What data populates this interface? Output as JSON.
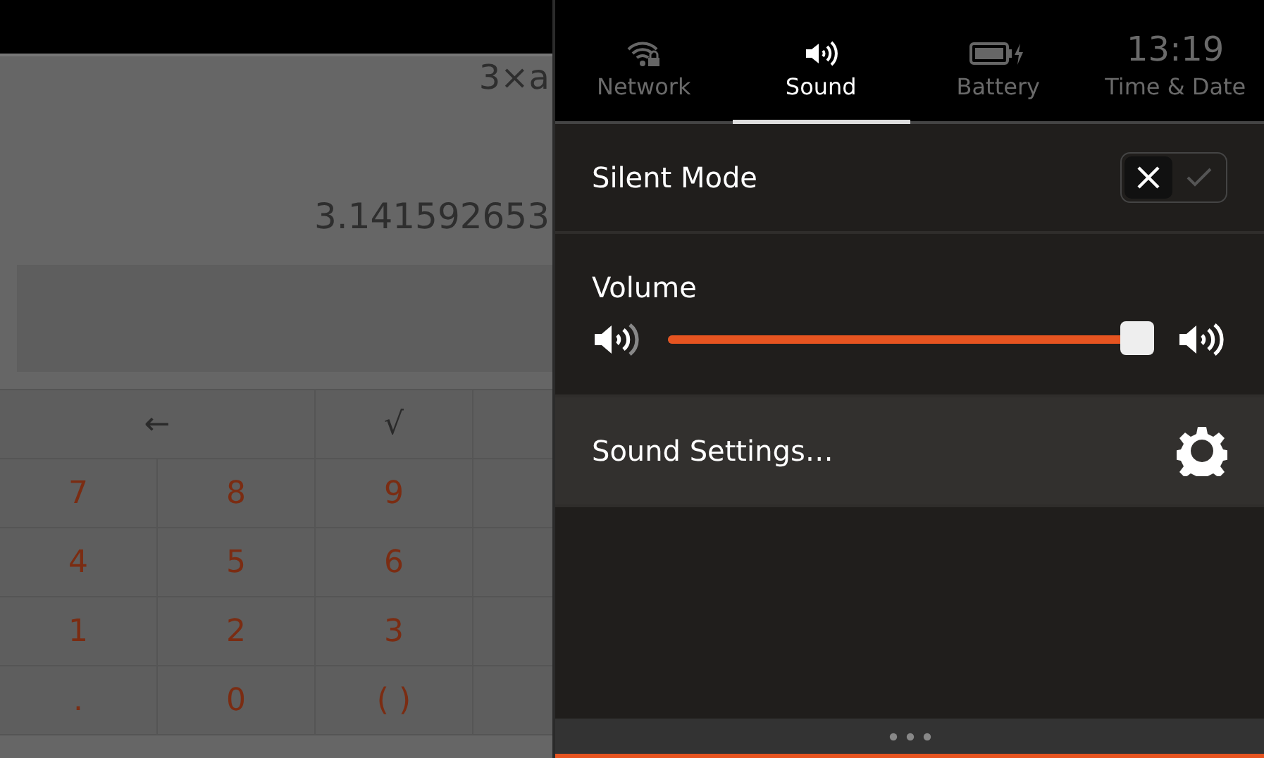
{
  "calculator": {
    "formula": "3×a",
    "result": "3.141592653",
    "keys": [
      {
        "label": "←",
        "kind": "op",
        "wide": true
      },
      {
        "label": "√",
        "kind": "op",
        "wide": false
      },
      {
        "label": "7",
        "kind": "digit",
        "wide": false
      },
      {
        "label": "8",
        "kind": "digit",
        "wide": false
      },
      {
        "label": "9",
        "kind": "digit",
        "wide": false
      },
      {
        "label": "4",
        "kind": "digit",
        "wide": false
      },
      {
        "label": "5",
        "kind": "digit",
        "wide": false
      },
      {
        "label": "6",
        "kind": "digit",
        "wide": false
      },
      {
        "label": "1",
        "kind": "digit",
        "wide": false
      },
      {
        "label": "2",
        "kind": "digit",
        "wide": false
      },
      {
        "label": "3",
        "kind": "digit",
        "wide": false
      },
      {
        "label": ".",
        "kind": "digit",
        "wide": false
      },
      {
        "label": "0",
        "kind": "digit",
        "wide": false
      },
      {
        "label": "( )",
        "kind": "digit",
        "wide": false
      }
    ]
  },
  "indicators": [
    {
      "label": "Network",
      "selected": false,
      "kind": "wifi"
    },
    {
      "label": "Sound",
      "selected": true,
      "kind": "speaker"
    },
    {
      "label": "Battery",
      "selected": false,
      "kind": "battery"
    },
    {
      "label": "Time & Date",
      "selected": false,
      "kind": "clock",
      "time": "13:19"
    }
  ],
  "silent_mode": {
    "label": "Silent Mode",
    "checked": false
  },
  "volume": {
    "label": "Volume",
    "level": 0.97
  },
  "sound_settings": {
    "label": "Sound Settings…"
  }
}
